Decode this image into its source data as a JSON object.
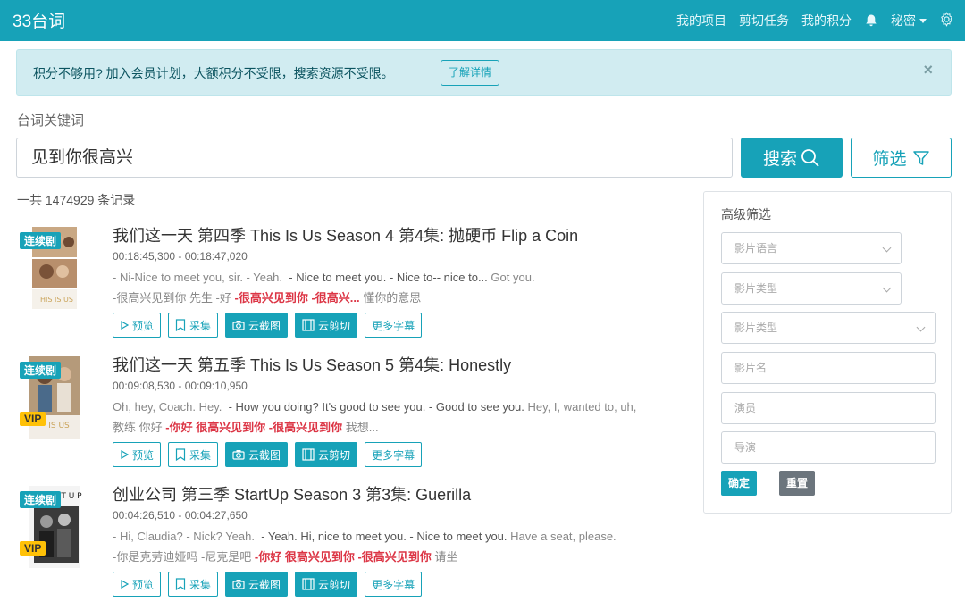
{
  "header": {
    "brand": "33台词",
    "nav": [
      "我的项目",
      "剪切任务",
      "我的积分"
    ],
    "user": "秘密"
  },
  "alert": {
    "text": "积分不够用? 加入会员计划，大额积分不受限，搜索资源不受限。",
    "button": "了解详情",
    "close": "×"
  },
  "search": {
    "label": "台词关键词",
    "value": "见到你很高兴",
    "search_button": "搜索",
    "filter_button": "筛选"
  },
  "total": "一共 1474929 条记录",
  "results": [
    {
      "tag": "连续剧",
      "vip": "",
      "title": "我们这一天 第四季 This Is Us Season 4 第4集: 抛硬币 Flip a Coin",
      "time": "00:18:45,300 - 00:18:47,020",
      "en_pre": "- Ni-Nice to meet you, sir. - Yeah.",
      "en_main": "- Nice to meet you. - Nice to-- nice to...",
      "en_post": "Got you.",
      "zh_pre": "-很高兴见到你 先生 -好",
      "zh_hl": "-很高兴见到你 -很高兴...",
      "zh_post": "懂你的意思"
    },
    {
      "tag": "连续剧",
      "vip": "VIP",
      "title": "我们这一天 第五季 This Is Us Season 5 第4集: Honestly",
      "time": "00:09:08,530 - 00:09:10,950",
      "en_pre": "Oh, hey, Coach. Hey.",
      "en_main": "- How you doing? It's good to see you. - Good to see you.",
      "en_post": "Hey, I, wanted to, uh,",
      "zh_pre": "教练 你好",
      "zh_hl": "-你好 很高兴见到你 -很高兴见到你",
      "zh_post": "我想..."
    },
    {
      "tag": "连续剧",
      "vip": "VIP",
      "title": "创业公司 第三季 StartUp Season 3 第3集: Guerilla",
      "time": "00:04:26,510 - 00:04:27,650",
      "en_pre": "- Hi, Claudia? - Nick? Yeah.",
      "en_main": "- Yeah. Hi, nice to meet you. - Nice to meet you.",
      "en_post": "Have a seat, please.",
      "zh_pre": "-你是克劳迪娅吗 -尼克是吧",
      "zh_hl": "-你好 很高兴见到你 -很高兴见到你",
      "zh_post": "请坐"
    }
  ],
  "actions": [
    "预览",
    "采集",
    "云截图",
    "云剪切",
    "更多字幕"
  ],
  "sidebar": {
    "title": "高级筛选",
    "lang": "影片语言",
    "type1": "影片类型",
    "type2": "影片类型",
    "name": "影片名",
    "actor": "演员",
    "director": "导演",
    "ok": "确定",
    "reset": "重置"
  },
  "colors": {
    "accent": "#17a2b8",
    "highlight": "#dc3545",
    "vip": "#ffc107"
  }
}
